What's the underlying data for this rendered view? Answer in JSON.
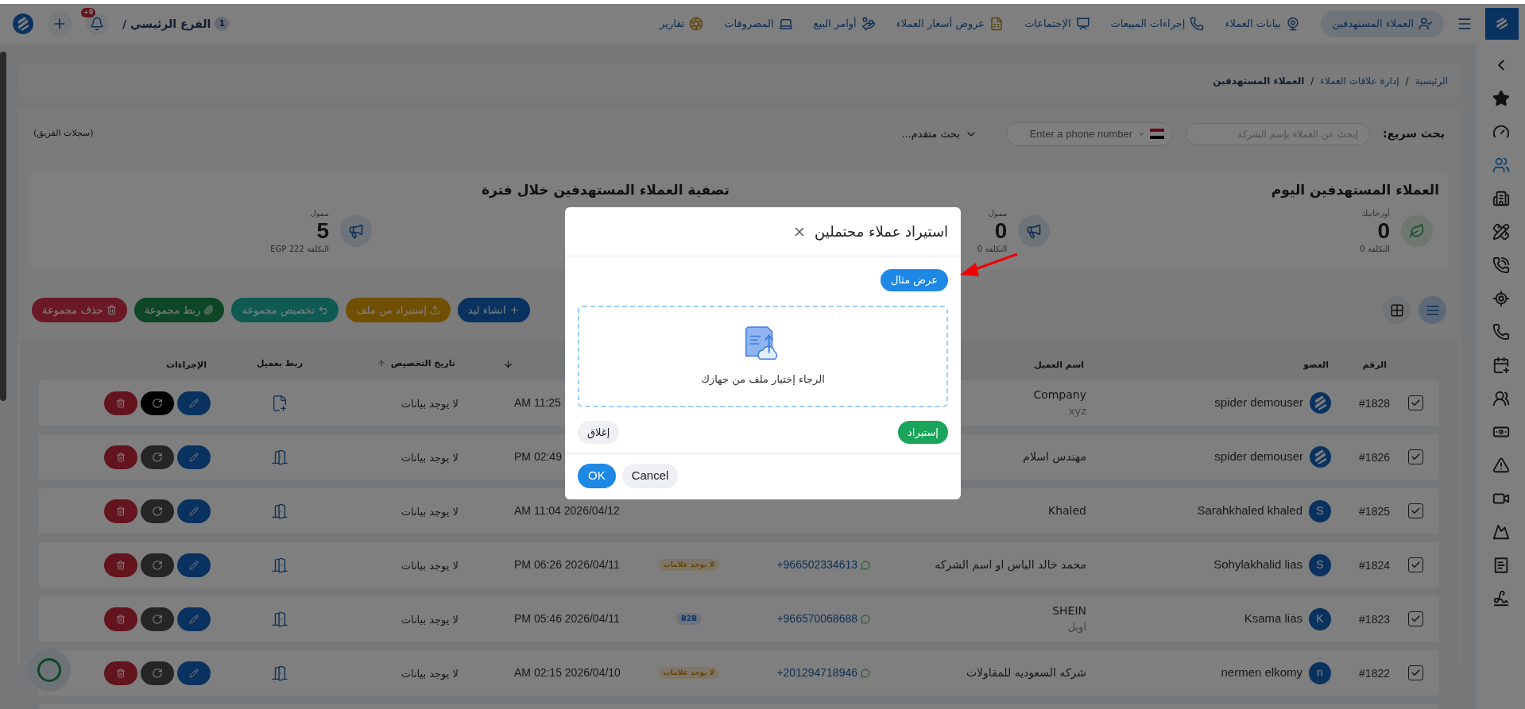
{
  "top_bar": {
    "nav_items": [
      {
        "label": "العملاء المستهدفين",
        "selected": true
      },
      {
        "label": "بيانات العملاء",
        "selected": false
      },
      {
        "label": "إجراءات المبيعات",
        "selected": false
      },
      {
        "label": "الإجتماعات",
        "selected": false
      },
      {
        "label": "عروض أسعار العملاء",
        "selected": false
      },
      {
        "label": "أوامر البيع",
        "selected": false
      },
      {
        "label": "المصروفات",
        "selected": false
      },
      {
        "label": "تقارير",
        "selected": false
      }
    ],
    "branch": {
      "count": "1",
      "name": "الفرع الرئيسي /"
    },
    "notifications_badge": "+9"
  },
  "sidebar": {
    "items": [
      {
        "selected": false
      },
      {
        "selected": false
      },
      {
        "selected": true
      },
      {
        "selected": false
      },
      {
        "selected": false
      },
      {
        "selected": false
      },
      {
        "selected": false
      },
      {
        "selected": false
      },
      {
        "selected": false
      },
      {
        "selected": false
      },
      {
        "selected": false
      },
      {
        "selected": false
      },
      {
        "selected": false
      },
      {
        "selected": false
      },
      {
        "selected": false
      },
      {
        "selected": false
      }
    ]
  },
  "breadcrumb": {
    "separator": "/",
    "items": [
      {
        "label": "الرئيسية",
        "current": false
      },
      {
        "label": "إدارة علاقات العملاء",
        "current": false
      },
      {
        "label": "العملاء المستهدفين",
        "current": true
      }
    ]
  },
  "search": {
    "label": "بحث سريع:",
    "company_placeholder": "إبحث عن العملاء بإسم الشركة",
    "phone_placeholder": "Enter a phone number",
    "advanced": "بحث متقدم...",
    "team_records": "(سجلات الفريق)"
  },
  "stats": [
    {
      "title": "العملاء المستهدفين اليوم",
      "items": [
        {
          "kind": "organic",
          "label": "أورجانيك",
          "value": "0",
          "cost": "التكلفة 0"
        },
        {
          "kind": "paid",
          "label": "ممول",
          "value": "0",
          "cost": "التكلفة 0"
        }
      ]
    },
    {
      "title": "تصفية العملاء المستهدفين خلال فترة",
      "items": [
        {
          "kind": "paid",
          "label": "ممول",
          "value": "5",
          "cost": "التكلفة 222 EGP"
        }
      ]
    }
  ],
  "view_toggle": [
    {
      "kind": "list",
      "selected": true
    },
    {
      "kind": "grid",
      "selected": false
    }
  ],
  "toolbar": [
    {
      "kind": "create",
      "label": "انشاء ليد"
    },
    {
      "kind": "import",
      "label": "إستيراد من ملف"
    },
    {
      "kind": "assign",
      "label": "تخصيص مجموعه"
    },
    {
      "kind": "link",
      "label": "ربط مجموعة"
    },
    {
      "kind": "delete",
      "label": "حذف مجموعة"
    }
  ],
  "table": {
    "columns": [
      "الرقم",
      "العضو",
      "اسم العميل",
      "تاريخ التخصيص",
      "ربط بعميل",
      "الإجراءات"
    ],
    "rows": [
      {
        "checked": true,
        "number": "#1828",
        "member": "spider demouser",
        "avatar": {
          "kind": "logo"
        },
        "client": "Company",
        "client_sub": "xyz",
        "date": "AM 11:25",
        "assigned": "لا يوجد بيانات",
        "link": {
          "kind": "add"
        },
        "refresh_active": true
      },
      {
        "checked": true,
        "number": "#1826",
        "member": "spider demouser",
        "avatar": {
          "kind": "logo"
        },
        "client": "مهندس اسلام",
        "date": "PM 02:49",
        "assigned": "لا يوجد بيانات",
        "link": {
          "kind": "linked"
        },
        "refresh_active": false
      },
      {
        "checked": true,
        "number": "#1825",
        "member": "Sarahkhaled khaled",
        "avatar": {
          "kind": "letter",
          "letter": "S"
        },
        "client": "Khaled",
        "date": "AM 11:04 2026/04/12",
        "assigned": "لا يوجد بيانات",
        "link": {
          "kind": "linked"
        },
        "refresh_active": false
      },
      {
        "checked": true,
        "number": "#1824",
        "member": "Sohylakhalid lias",
        "avatar": {
          "kind": "letter",
          "letter": "S"
        },
        "client": "محمد خالد الياس او اسم الشركه",
        "phone": "+966502334613",
        "tag": {
          "kind": "none",
          "label": "لا يوجد علامات"
        },
        "date": "PM 06:26 2026/04/11",
        "assigned": "لا يوجد بيانات",
        "link": {
          "kind": "linked"
        },
        "refresh_active": false
      },
      {
        "checked": true,
        "number": "#1823",
        "member": "Ksama lias",
        "avatar": {
          "kind": "letter",
          "letter": "K"
        },
        "client": "SHEIN",
        "client_sub": "اوبل",
        "phone": "+966570068688",
        "tag": {
          "kind": "segment",
          "label": "B2B"
        },
        "date": "PM 05:46 2026/04/11",
        "assigned": "لا يوجد بيانات",
        "link": {
          "kind": "linked"
        },
        "refresh_active": false
      },
      {
        "checked": true,
        "number": "#1822",
        "member": "nermen elkomy",
        "avatar": {
          "kind": "letter",
          "letter": "n"
        },
        "client": "شركه السعوديه للمقاولات",
        "phone": "+201294718946",
        "tag": {
          "kind": "none",
          "label": "لا يوجد علامات"
        },
        "date": "AM 02:15 2026/04/10",
        "assigned": "لا يوجد بيانات",
        "link": {
          "kind": "linked"
        },
        "refresh_active": false
      }
    ]
  },
  "modal": {
    "title": "استيراد عملاء محتملين",
    "show_example": "عرض مثال",
    "dropzone_text": "الرجاء إختيار ملف من جهازك",
    "import": "إستيراد",
    "close": "إغلاق",
    "ok": "OK",
    "cancel": "Cancel"
  }
}
